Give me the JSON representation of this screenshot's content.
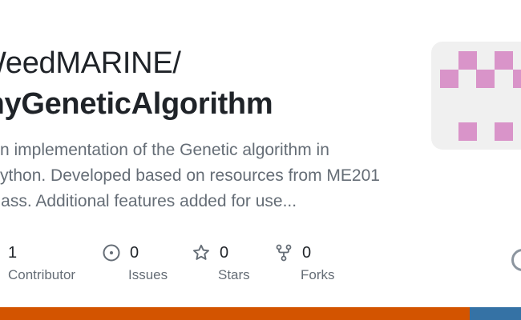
{
  "repo": {
    "owner": "WeedMARINE/",
    "name": "myGeneticAlgorithm",
    "description": "An implementation of the Genetic algorithm in\nPython. Developed based on resources from ME201\nclass. Additional features added for use..."
  },
  "stats": [
    {
      "value": "1",
      "label": "Contributor",
      "icon": "contributor-icon"
    },
    {
      "value": "0",
      "label": "Issues",
      "icon": "issue-icon"
    },
    {
      "value": "0",
      "label": "Stars",
      "icon": "star-icon"
    },
    {
      "value": "0",
      "label": "Forks",
      "icon": "fork-icon"
    }
  ],
  "colors": {
    "avatar_pixel": "#d994c9",
    "language_primary": "#d35400",
    "language_secondary": "#3572a5"
  }
}
